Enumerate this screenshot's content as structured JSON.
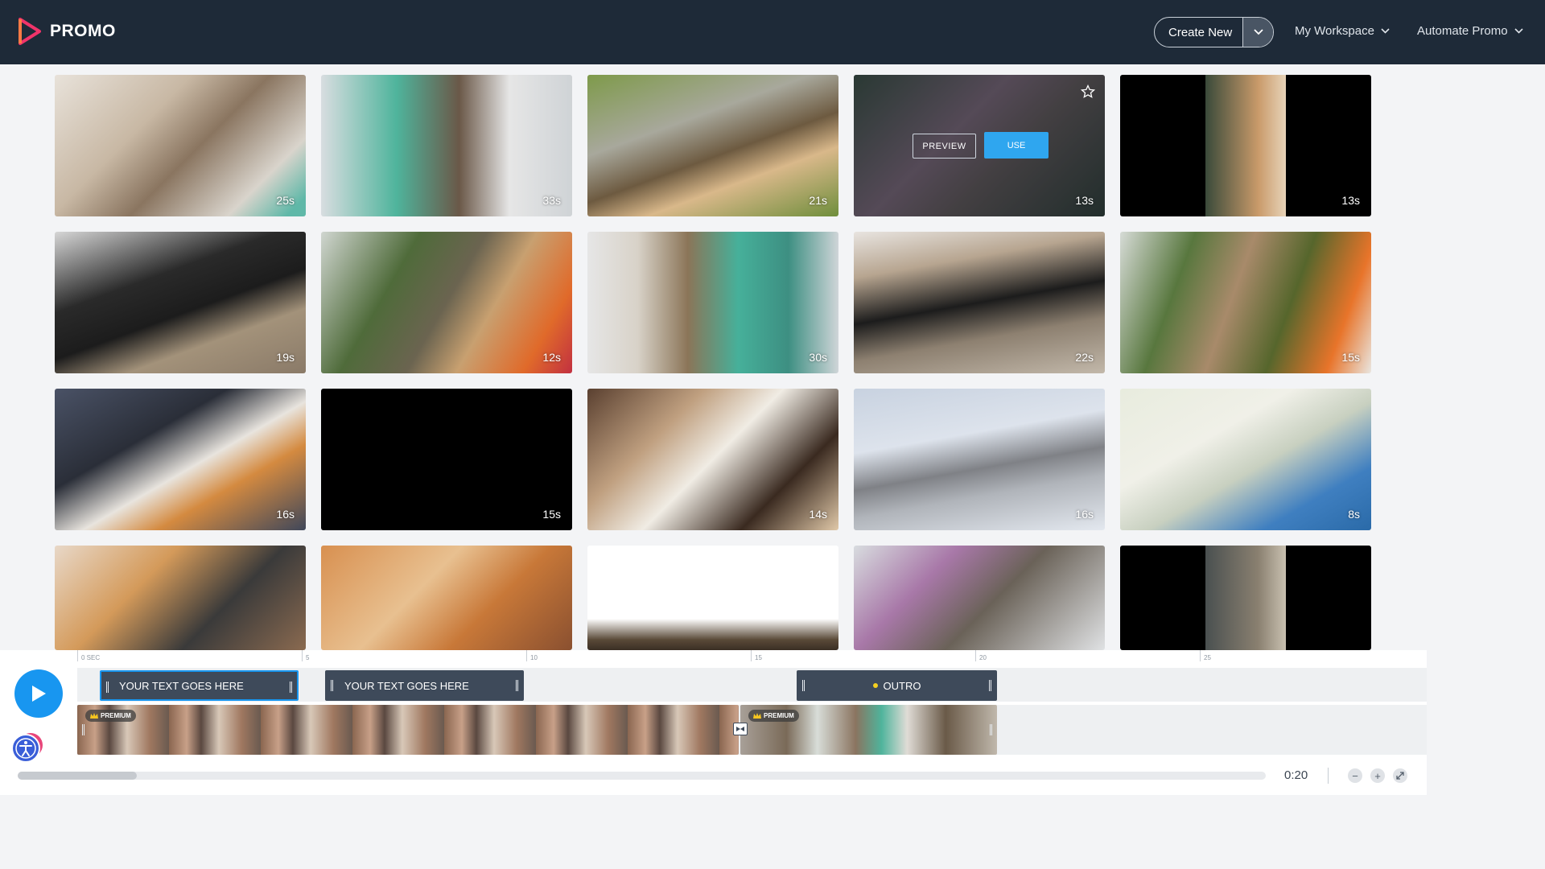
{
  "header": {
    "logo_text": "PROMO",
    "create_new_label": "Create New",
    "workspace_label": "My Workspace",
    "automate_label": "Automate Promo"
  },
  "grid": {
    "tiles": [
      {
        "duration": "25s"
      },
      {
        "duration": "33s"
      },
      {
        "duration": "21s"
      },
      {
        "duration": "13s",
        "hovered": true
      },
      {
        "duration": "13s"
      },
      {
        "duration": "19s"
      },
      {
        "duration": "12s"
      },
      {
        "duration": "30s"
      },
      {
        "duration": "22s"
      },
      {
        "duration": "15s"
      },
      {
        "duration": "16s"
      },
      {
        "duration": "15s"
      },
      {
        "duration": "14s"
      },
      {
        "duration": "16s"
      },
      {
        "duration": "8s"
      },
      {
        "duration": ""
      },
      {
        "duration": ""
      },
      {
        "duration": ""
      },
      {
        "duration": ""
      },
      {
        "duration": ""
      }
    ],
    "preview_label": "PREVIEW",
    "use_label": "USE"
  },
  "timeline": {
    "ruler_ticks": [
      "0 SEC",
      "5",
      "10",
      "15",
      "20",
      "25"
    ],
    "text_clips": [
      {
        "label": "YOUR TEXT GOES HERE"
      },
      {
        "label": "YOUR TEXT GOES HERE"
      },
      {
        "label": "OUTRO"
      }
    ],
    "premium_label": "PREMIUM",
    "time": "0:20",
    "zoom_out": "−",
    "zoom_in": "+"
  },
  "colors": {
    "header_bg": "#1e2a38",
    "accent": "#1896f0",
    "logo_pink": "#f0346a"
  }
}
